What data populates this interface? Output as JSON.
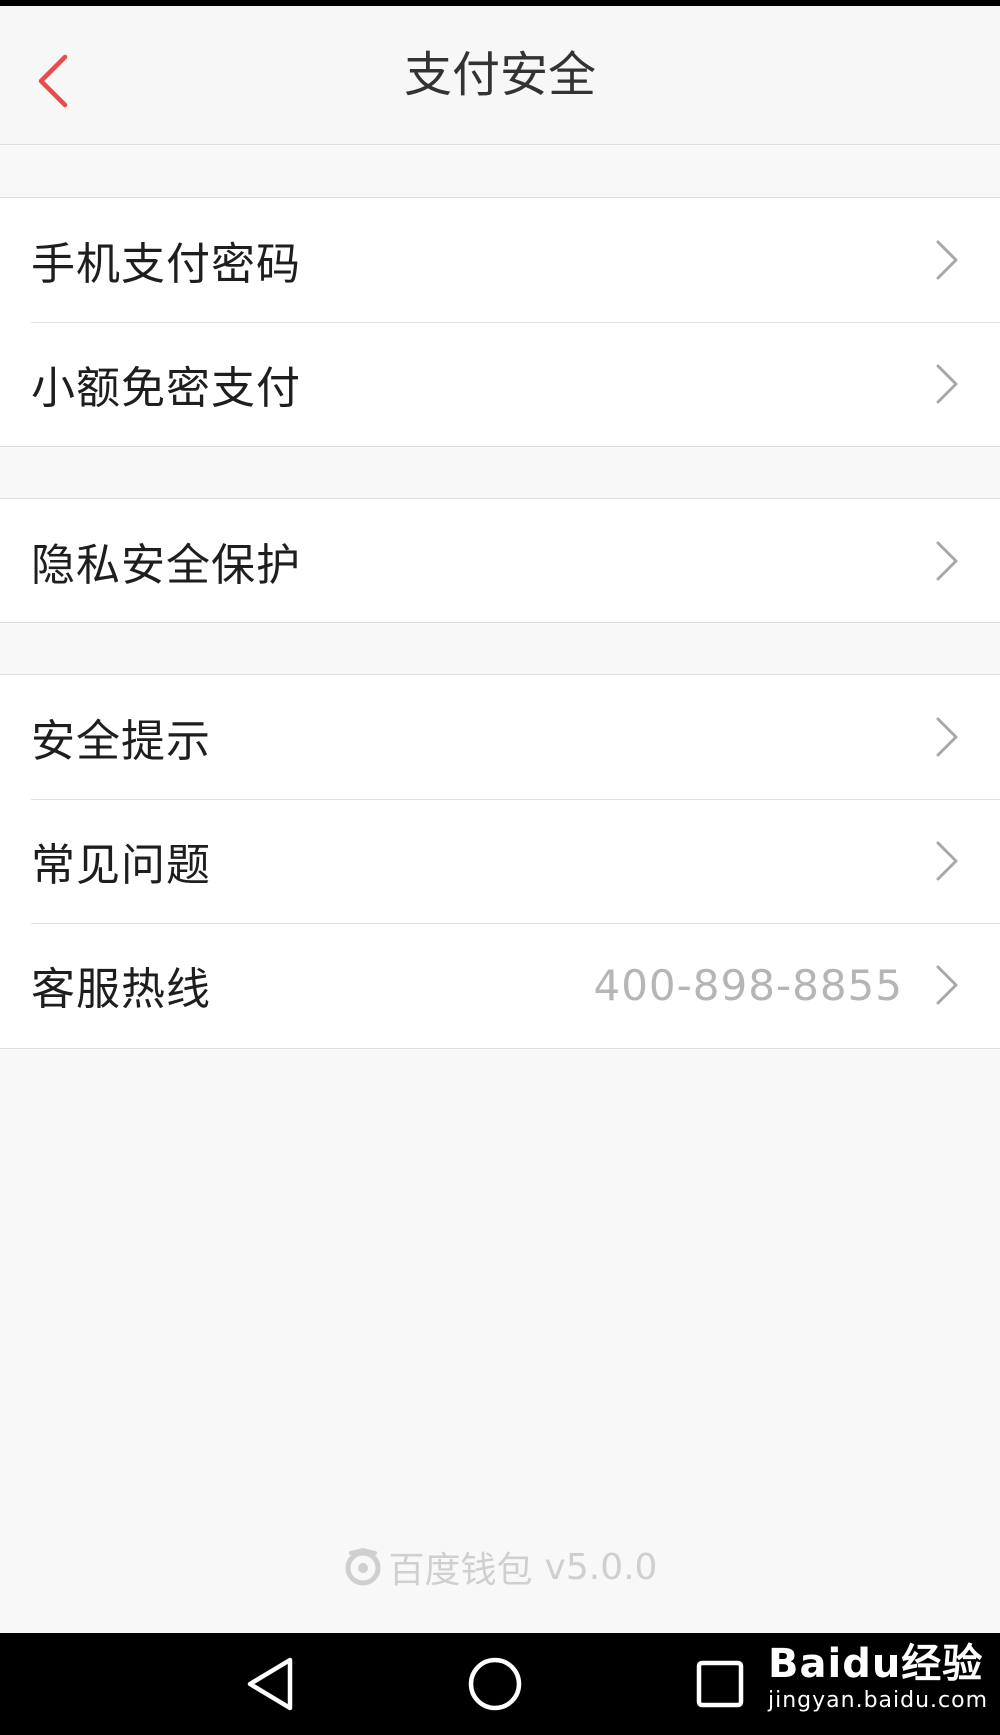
{
  "header": {
    "title": "支付安全",
    "back_icon": "chevron-left-icon",
    "accent_color": "#e94b4b"
  },
  "groups": [
    {
      "items": [
        {
          "label": "手机支付密码",
          "value": ""
        },
        {
          "label": "小额免密支付",
          "value": ""
        }
      ]
    },
    {
      "items": [
        {
          "label": "隐私安全保护",
          "value": ""
        }
      ]
    },
    {
      "items": [
        {
          "label": "安全提示",
          "value": ""
        },
        {
          "label": "常见问题",
          "value": ""
        },
        {
          "label": "客服热线",
          "value": "400-898-8855"
        }
      ]
    }
  ],
  "footer": {
    "brand": "百度钱包",
    "version": "v5.0.0"
  },
  "nav": {
    "back_icon": "triangle-back-icon",
    "home_icon": "circle-home-icon",
    "recent_icon": "square-recent-icon"
  },
  "watermark": {
    "logo": "Baidu经验",
    "url": "jingyan.baidu.com"
  }
}
